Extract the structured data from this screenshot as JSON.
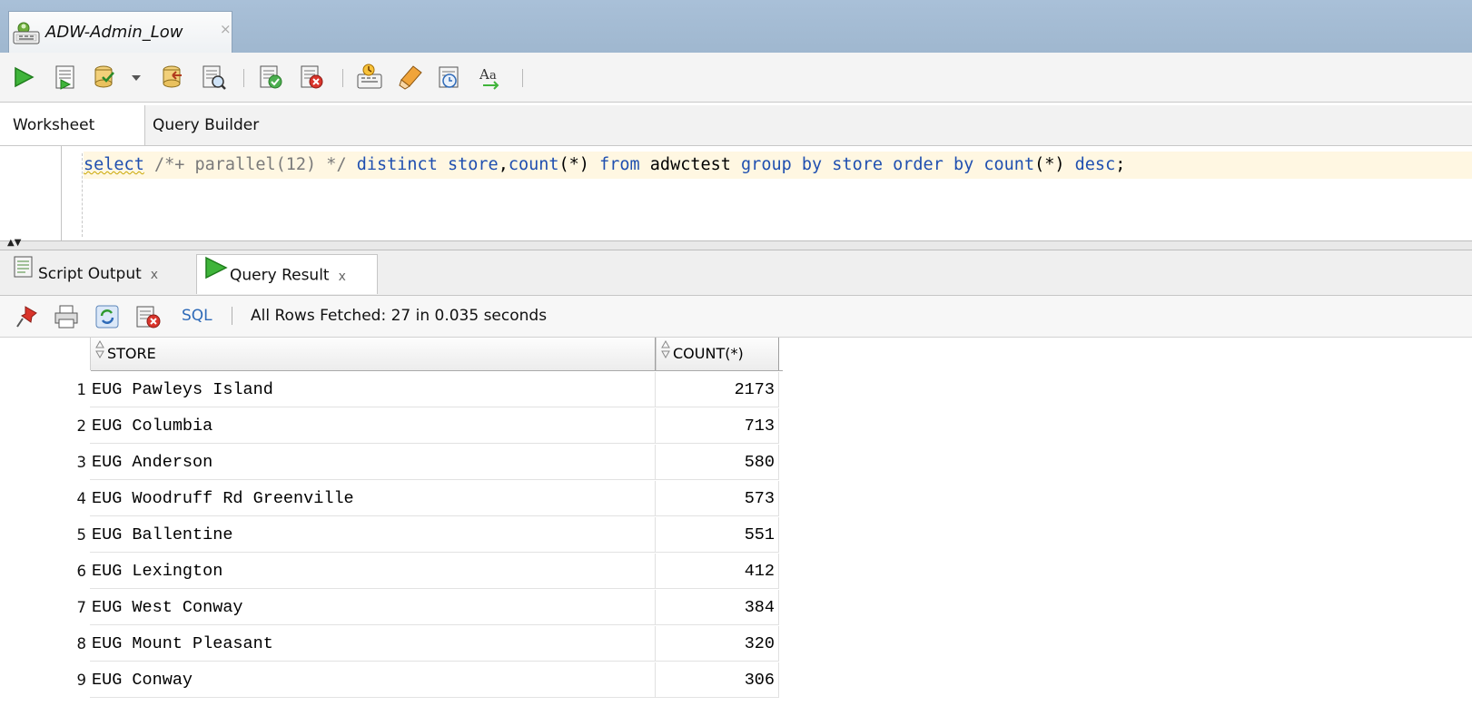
{
  "document_tab": {
    "title": "ADW-Admin_Low",
    "close": "×"
  },
  "toolbar": {
    "buttons": [
      "run-statement-icon",
      "run-script-icon",
      "commit-icon",
      "dropdown-arrow-icon",
      "rollback-icon",
      "explain-plan-icon",
      "autotrace-icon",
      "sql-tuning-icon",
      "sql-history-icon",
      "clear-icon",
      "sql-monitor-icon",
      "format-icon"
    ]
  },
  "worksheet_tabs": [
    "Worksheet",
    "Query Builder"
  ],
  "editor": {
    "parts": [
      {
        "t": "select",
        "c": "kw"
      },
      {
        "t": " /*+ parallel(12) */ ",
        "c": "cm"
      },
      {
        "t": "distinct",
        "c": "kw"
      },
      {
        "t": " ",
        "c": ""
      },
      {
        "t": "store",
        "c": "kw"
      },
      {
        "t": ",",
        "c": ""
      },
      {
        "t": "count",
        "c": "kw"
      },
      {
        "t": "(*) ",
        "c": ""
      },
      {
        "t": "from",
        "c": "kw"
      },
      {
        "t": " adwctest ",
        "c": ""
      },
      {
        "t": "group by",
        "c": "kw"
      },
      {
        "t": " ",
        "c": ""
      },
      {
        "t": "store",
        "c": "kw"
      },
      {
        "t": " ",
        "c": ""
      },
      {
        "t": "order by",
        "c": "kw"
      },
      {
        "t": " ",
        "c": ""
      },
      {
        "t": "count",
        "c": "kw"
      },
      {
        "t": "(*) ",
        "c": ""
      },
      {
        "t": "desc",
        "c": "kw"
      },
      {
        "t": ";",
        "c": ""
      }
    ]
  },
  "result_tabs": [
    {
      "label": "Script Output",
      "close": "x"
    },
    {
      "label": "Query Result",
      "close": "x"
    }
  ],
  "result_toolbar": {
    "sql_link": "SQL",
    "status": "All Rows Fetched: 27 in 0.035 seconds"
  },
  "grid": {
    "columns": [
      "STORE",
      "COUNT(*)"
    ],
    "rows": [
      {
        "n": "1",
        "store": "EUG Pawleys Island",
        "count": "2173"
      },
      {
        "n": "2",
        "store": "EUG Columbia",
        "count": "713"
      },
      {
        "n": "3",
        "store": "EUG Anderson",
        "count": "580"
      },
      {
        "n": "4",
        "store": "EUG Woodruff Rd Greenville",
        "count": "573"
      },
      {
        "n": "5",
        "store": "EUG Ballentine",
        "count": "551"
      },
      {
        "n": "6",
        "store": "EUG Lexington",
        "count": "412"
      },
      {
        "n": "7",
        "store": "EUG West Conway",
        "count": "384"
      },
      {
        "n": "8",
        "store": "EUG Mount Pleasant",
        "count": "320"
      },
      {
        "n": "9",
        "store": "EUG Conway",
        "count": "306"
      }
    ]
  }
}
